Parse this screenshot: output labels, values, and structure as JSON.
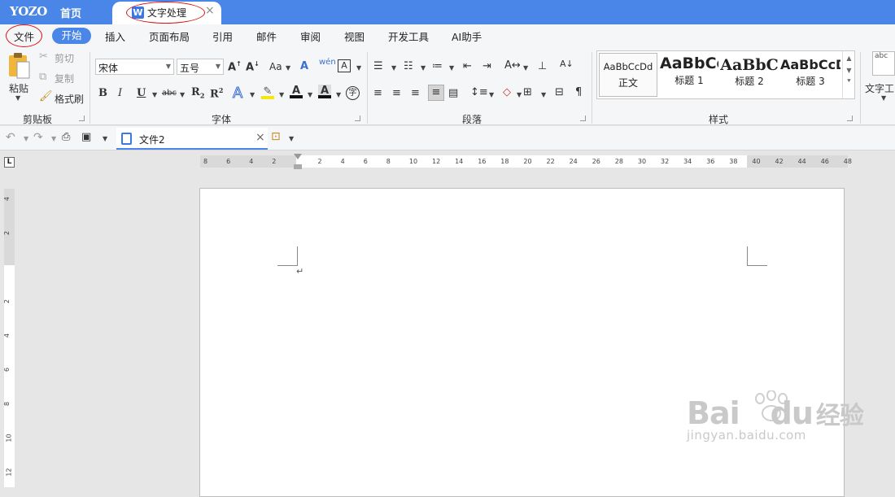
{
  "titlebar": {
    "brand": "YOZO",
    "home": "首页",
    "active_tab": "文字处理",
    "active_tab_icon": "W",
    "close": "×"
  },
  "menubar": {
    "items": [
      "文件",
      "开始",
      "插入",
      "页面布局",
      "引用",
      "邮件",
      "审阅",
      "视图",
      "开发工具",
      "AI助手"
    ]
  },
  "ribbon": {
    "clipboard": {
      "paste": "粘贴",
      "cut": "剪切",
      "copy": "复制",
      "format_painter": "格式刷",
      "label": "剪贴板"
    },
    "font": {
      "name": "宋体",
      "size": "五号",
      "case_label": "Aa",
      "pinyin": "wén",
      "label": "字体",
      "bold": "B",
      "italic": "I",
      "underline": "U",
      "strike": "abc",
      "sub": "R",
      "sup": "R",
      "sub2": "2",
      "sup2": "2"
    },
    "paragraph": {
      "label": "段落"
    },
    "styles": {
      "label": "样式",
      "items": [
        {
          "sample": "AaBbCcDd",
          "name": "正文"
        },
        {
          "sample": "AaBbCc",
          "name": "标题 1"
        },
        {
          "sample": "AaBbC",
          "name": "标题 2"
        },
        {
          "sample": "AaBbCcD",
          "name": "标题 3"
        }
      ]
    },
    "text_tools": {
      "label": "文字工",
      "icon_text": "abc"
    }
  },
  "doc_tab": {
    "name": "文件2",
    "close": "×"
  },
  "hruler": {
    "ticks": [
      "8",
      "6",
      "4",
      "2",
      "2",
      "4",
      "6",
      "8",
      "10",
      "12",
      "14",
      "16",
      "18",
      "20",
      "22",
      "24",
      "26",
      "28",
      "30",
      "32",
      "34",
      "36",
      "38",
      "40",
      "42",
      "44",
      "46",
      "48"
    ]
  },
  "vruler": {
    "ticks": [
      "4",
      "2",
      "2",
      "4",
      "6",
      "8",
      "10",
      "12"
    ],
    "corner": "L"
  },
  "page": {
    "paragraph_mark": "↵"
  },
  "watermark": {
    "main": "Bai",
    "main2": "du",
    "brand_cn": "经验",
    "sub": "jingyan.baidu.com"
  },
  "colors": {
    "accent": "#4a86e8",
    "highlight_marker": "#d11111"
  }
}
